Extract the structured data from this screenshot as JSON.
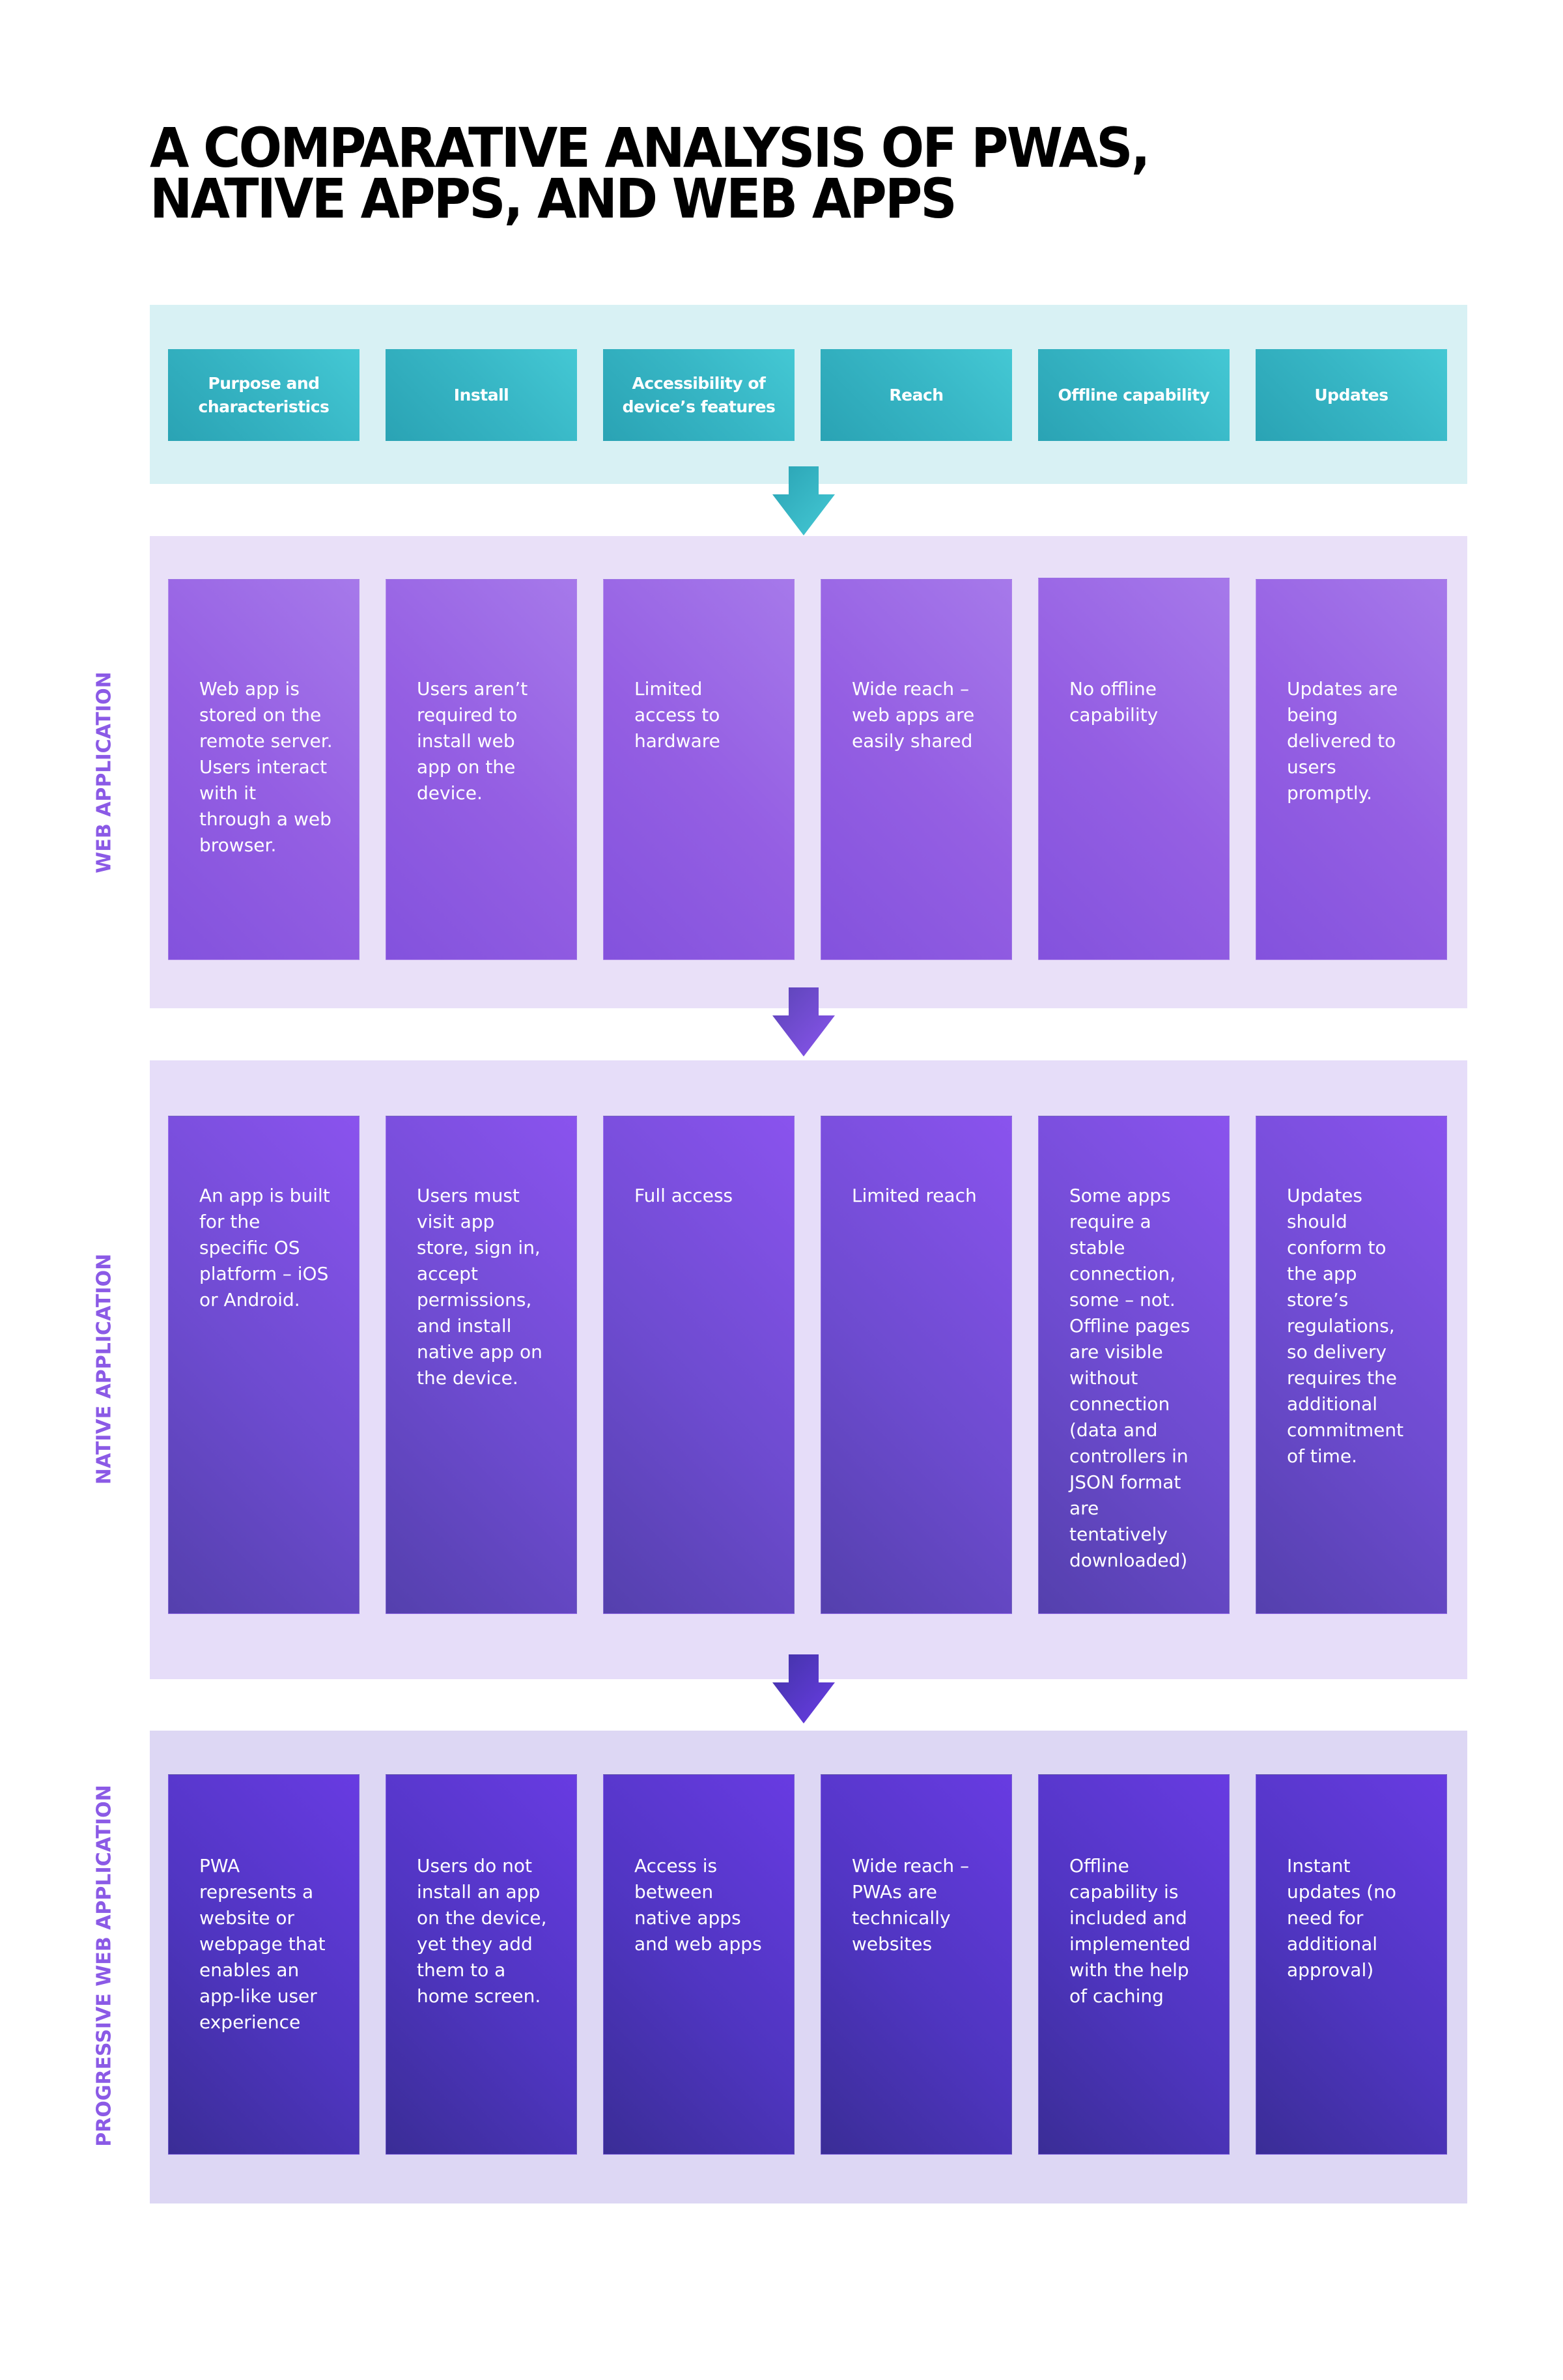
{
  "title": "A comparative analysis of PWAs, native apps, and web apps",
  "colors": {
    "header_band": "#d8f1f4",
    "header_cell": "#37b6c5",
    "web_band": "#e9e0f8",
    "native_band": "#e6ddf9",
    "pwa_band": "#ddd7f4",
    "side_label": "#8b5ae6",
    "web_card": "#955fe3",
    "native_card": "#6d4bcf",
    "pwa_card": "#4f35c0"
  },
  "columns": [
    "Purpose and characteristics",
    "Install",
    "Accessibility of device’s features",
    "Reach",
    "Offline capability",
    "Updates"
  ],
  "rows": [
    {
      "label": "WEB APPLICATION",
      "cells": [
        "Web app is stored on the remote server. Users interact with it through a web browser.",
        "Users aren’t required to install web app on the device.",
        "Limited access to hardware",
        "Wide reach – web apps are easily shared",
        "No offline capability",
        "Updates are being delivered to users promptly."
      ]
    },
    {
      "label": "NATIVE APPLICATION",
      "cells": [
        "An app is built for the specific OS platform – iOS or Android.",
        "Users must visit app store, sign in, accept permissions, and install native app on the device.",
        "Full access",
        "Limited reach",
        "Some apps require a stable connection, some – not. Offline pages are visible without connection (data and controllers in JSON format are tentatively downloaded)",
        "Updates should conform to the app store’s regulations, so delivery requires the additional commitment of time."
      ]
    },
    {
      "label": "PROGRESSIVE WEB APPLICATION",
      "cells": [
        "PWA represents a website or webpage that enables an app-like user experience",
        "Users do not install an app on the device, yet they add them to a home screen.",
        "Access is between native apps and web apps",
        "Wide reach – PWAs are technically websites",
        "Offline capability is included and implemented with the help of caching",
        "Instant updates (no need for additional approval)"
      ]
    }
  ],
  "arrows": [
    {
      "icon": "down-arrow-icon",
      "color": "#37b6c5"
    },
    {
      "icon": "down-arrow-icon",
      "color": "#7a4fe0"
    },
    {
      "icon": "down-arrow-icon",
      "color": "#5537c8"
    }
  ]
}
